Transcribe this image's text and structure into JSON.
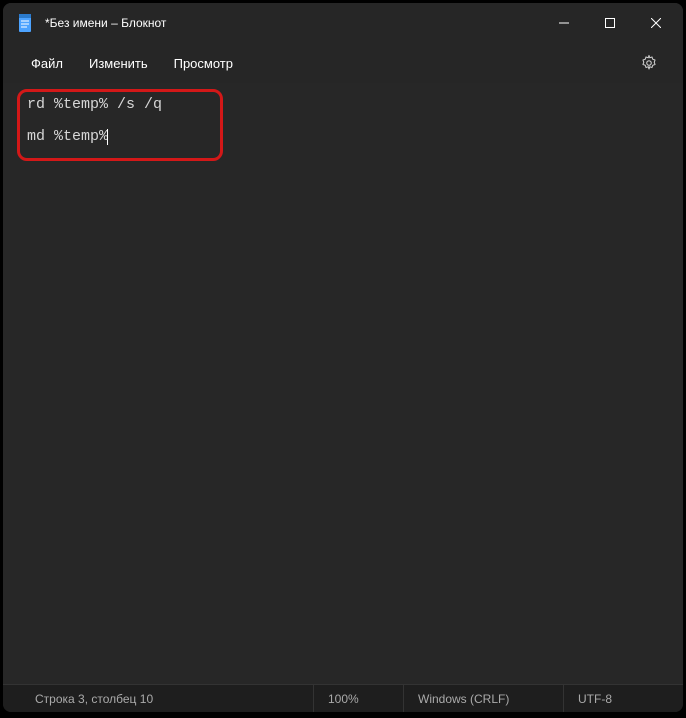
{
  "titlebar": {
    "title": "*Без имени – Блокнот"
  },
  "menubar": {
    "file": "Файл",
    "edit": "Изменить",
    "view": "Просмотр"
  },
  "editor": {
    "line1": "rd %temp% /s /q",
    "line2": "md %temp%"
  },
  "statusbar": {
    "position": "Строка 3, столбец 10",
    "zoom": "100%",
    "lineending": "Windows (CRLF)",
    "encoding": "UTF-8"
  }
}
